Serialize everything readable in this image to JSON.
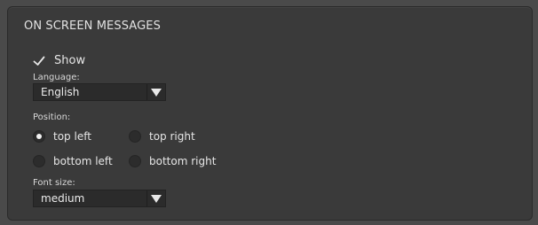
{
  "panel": {
    "title": "ON SCREEN MESSAGES"
  },
  "show": {
    "label": "Show",
    "checked": true
  },
  "language": {
    "label": "Language:",
    "selected": "English"
  },
  "position": {
    "label": "Position:",
    "options": [
      {
        "label": "top left",
        "selected": true
      },
      {
        "label": "top right",
        "selected": false
      },
      {
        "label": "bottom left",
        "selected": false
      },
      {
        "label": "bottom right",
        "selected": false
      }
    ]
  },
  "font_size": {
    "label": "Font size:",
    "selected": "medium"
  },
  "icons": {
    "check": "checkmark-icon",
    "dropdown": "triangle-down-icon"
  },
  "colors": {
    "background": "#4a4a4a",
    "panel": "#3a3a3a",
    "control": "#2b2b2b",
    "text": "#e6e6e6"
  }
}
